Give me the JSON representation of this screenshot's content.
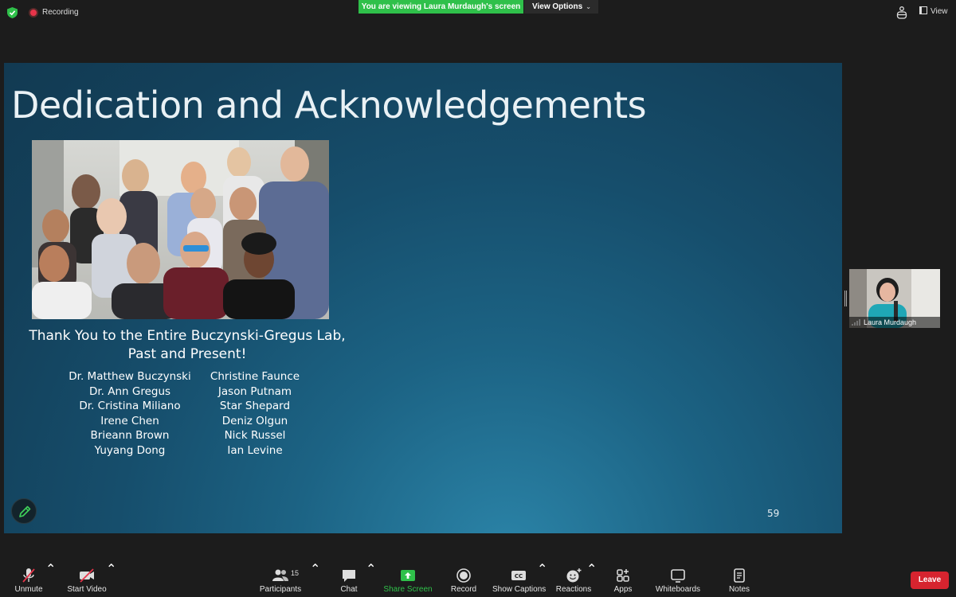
{
  "topbar": {
    "recording_label": "Recording",
    "viewing_banner": "You are viewing Laura Murdaugh's screen",
    "view_options_label": "View Options",
    "view_label": "View"
  },
  "slide": {
    "title": "Dedication and Acknowledgements",
    "thanks_line1": "Thank You to the Entire Buczynski-Gregus Lab,",
    "thanks_line2": "Past and Present!",
    "names_col1": [
      "Dr. Matthew Buczynski",
      "Dr. Ann Gregus",
      "Dr. Cristina Miliano",
      "Irene Chen",
      "Brieann Brown",
      "Yuyang Dong"
    ],
    "names_col2": [
      "Christine Faunce",
      "Jason Putnam",
      "Star Shepard",
      "Deniz Olgun",
      "Nick Russel",
      "Ian Levine"
    ],
    "page_number": "59"
  },
  "participant_thumb": {
    "name": "Laura Murdaugh"
  },
  "toolbar": {
    "unmute": "Unmute",
    "start_video": "Start Video",
    "participants": "Participants",
    "participants_count": "15",
    "chat": "Chat",
    "share_screen": "Share Screen",
    "record": "Record",
    "show_captions": "Show Captions",
    "reactions": "Reactions",
    "apps": "Apps",
    "whiteboards": "Whiteboards",
    "notes": "Notes",
    "leave": "Leave"
  },
  "colors": {
    "accent_green": "#2fc04a",
    "leave_red": "#d6242f",
    "recording_red": "#e8344a",
    "slide_blue": "#164e6c"
  },
  "icons": [
    "shield-icon",
    "record-dot-icon",
    "glasses-icon",
    "view-icon",
    "pen-icon",
    "microphone-muted-icon",
    "video-off-icon",
    "participants-icon",
    "chat-icon",
    "share-screen-icon",
    "record-icon",
    "captions-icon",
    "reactions-icon",
    "apps-icon",
    "whiteboard-icon",
    "notes-icon",
    "signal-icon"
  ]
}
